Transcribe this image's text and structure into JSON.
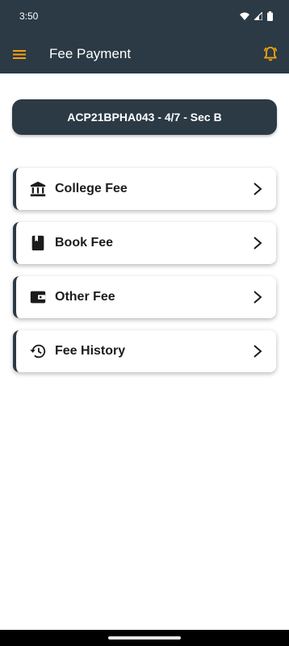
{
  "status_bar": {
    "time": "3:50"
  },
  "app_bar": {
    "title": "Fee Payment"
  },
  "student": {
    "label": "ACP21BPHA043 - 4/7 - Sec B"
  },
  "menu_items": [
    {
      "label": "College Fee",
      "icon": "bank-icon"
    },
    {
      "label": "Book Fee",
      "icon": "book-icon"
    },
    {
      "label": "Other Fee",
      "icon": "wallet-icon"
    },
    {
      "label": "Fee History",
      "icon": "history-icon"
    }
  ],
  "colors": {
    "primary": "#2b3a45",
    "accent": "#f2a20d",
    "background": "#ffffff"
  }
}
